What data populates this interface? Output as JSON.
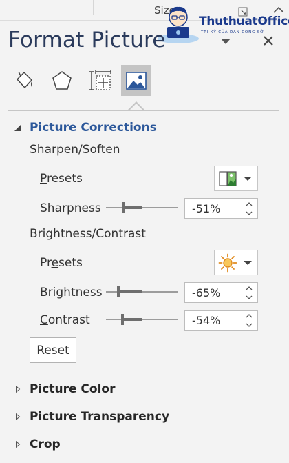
{
  "ribbon": {
    "size_label": "Size"
  },
  "logo": {
    "name": "ThuthuatOffice",
    "tagline": "TRI KỶ CỦA DÂN CÔNG SỞ"
  },
  "pane": {
    "title": "Format Picture",
    "tabs": [
      {
        "name": "fill-line",
        "icon": "paint-bucket-icon",
        "active": false
      },
      {
        "name": "effects",
        "icon": "pentagon-icon",
        "active": false
      },
      {
        "name": "size-properties",
        "icon": "size-properties-icon",
        "active": false
      },
      {
        "name": "picture",
        "icon": "picture-icon",
        "active": true
      }
    ]
  },
  "corrections": {
    "title": "Picture Corrections",
    "sharpen": {
      "label": "Sharpen/Soften",
      "presets_label_u": "P",
      "presets_label_rest": "resets",
      "sharpness_label": "Sharpness",
      "sharpness_value": "-51%",
      "sharpness_level": -0.51
    },
    "brightness": {
      "label": "Brightness/Contrast",
      "presets_label_pre": "Pr",
      "presets_label_u": "e",
      "presets_label_rest": "sets",
      "brightness_label_u": "B",
      "brightness_label_rest": "rightness",
      "brightness_value": "-65%",
      "brightness_level": -0.65,
      "contrast_label_u": "C",
      "contrast_label_rest": "ontrast",
      "contrast_value": "-54%",
      "contrast_level": -0.54
    },
    "reset_u": "R",
    "reset_rest": "eset"
  },
  "sections": {
    "picture_color": "Picture Color",
    "picture_transparency": "Picture Transparency",
    "crop": "Crop"
  },
  "colors": {
    "accent": "#2b579a",
    "sun": "#f0a030"
  }
}
